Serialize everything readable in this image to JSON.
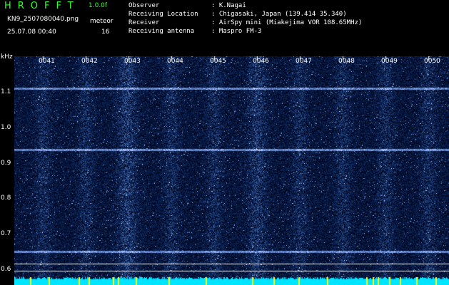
{
  "header": {
    "app_title": "HROFFT",
    "app_version": "1.0.0f",
    "file_name": "KN9_2507080040.png",
    "timestamp": "25.07.08 00:40",
    "meteor_label": "meteor",
    "meteor_count": "16"
  },
  "info": [
    {
      "label": "Observer",
      "value": ": K.Nagai"
    },
    {
      "label": "Receiving Location",
      "value": ": Chigasaki, Japan (139.414 35.340)"
    },
    {
      "label": "Receiver",
      "value": ": AirSpy mini (Miakejima VOR 108.65MHz)"
    },
    {
      "label": "Receiving antenna",
      "value": ": Maspro FM-3"
    }
  ],
  "spectrogram": {
    "unit_label": "kHz",
    "y_ticks": [
      "1.1",
      "1.0",
      "0.9",
      "0.8",
      "0.7",
      "0.6"
    ],
    "x_ticks": [
      "0041",
      "0042",
      "0043",
      "0044",
      "0045",
      "0046",
      "0047",
      "0048",
      "0049",
      "0050"
    ],
    "colors": {
      "background": "#000000",
      "noise_blue": "#1e3cc8",
      "carrier_line": "#b4dcff",
      "baseline": "#00e5ff",
      "marker": "#ffff00"
    }
  }
}
